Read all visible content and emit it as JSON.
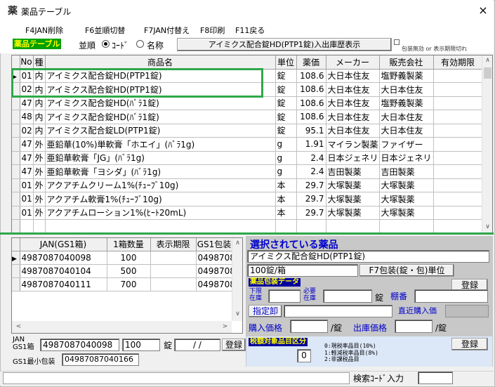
{
  "window": {
    "title": "薬品テーブル",
    "close_glyph": "×",
    "app_icon_glyph": "薬"
  },
  "menu": {
    "jan_delete": "F4JAN削除",
    "sort_toggle": "F6並順切替",
    "jan_toggle": "F7JAN付替え",
    "print": "F8印刷",
    "back": "F11戻る"
  },
  "toolbar": {
    "table_tag": "薬品テーブル",
    "sort_label": "並順",
    "sort_options": {
      "code": "ｺｰﾄﾞ",
      "name": "名称",
      "selected": "code"
    },
    "history_button": "アイミクス配合錠HD(PTP1錠)入出庫歴表示",
    "note": "包装無効 or 表示期限切れ"
  },
  "main_table": {
    "headers": [
      "No",
      "種",
      "商品名",
      "単位",
      "薬価",
      "メーカー",
      "販売会社",
      "有効期限"
    ],
    "rows": [
      {
        "no": "01",
        "type": "内",
        "name": "アイミクス配合錠HD(PTP1錠)",
        "unit": "錠",
        "price": "108.6",
        "maker": "大日本住友",
        "seller": "塩野義製薬",
        "expiry": "",
        "current": true
      },
      {
        "no": "02",
        "type": "内",
        "name": "アイミクス配合錠HD(PTP1錠)",
        "unit": "錠",
        "price": "108.6",
        "maker": "大日本住友",
        "seller": "大日本住友",
        "expiry": ""
      },
      {
        "no": "47",
        "type": "内",
        "name": "アイミクス配合錠HD(ﾊﾞﾗ1錠)",
        "unit": "錠",
        "price": "108.6",
        "maker": "大日本住友",
        "seller": "塩野義製薬",
        "expiry": ""
      },
      {
        "no": "48",
        "type": "内",
        "name": "アイミクス配合錠HD(ﾊﾞﾗ1錠)",
        "unit": "錠",
        "price": "108.6",
        "maker": "大日本住友",
        "seller": "大日本住友",
        "expiry": ""
      },
      {
        "no": "02",
        "type": "内",
        "name": "アイミクス配合錠LD(PTP1錠)",
        "unit": "錠",
        "price": "95.1",
        "maker": "大日本住友",
        "seller": "大日本住友",
        "expiry": ""
      },
      {
        "no": "47",
        "type": "外",
        "name": "亜鉛華(10%)単軟膏「ホエイ」(ﾊﾞﾗ1g)",
        "unit": "g",
        "price": "1.91",
        "maker": "マイラン製薬",
        "seller": "ファイザー",
        "expiry": ""
      },
      {
        "no": "47",
        "type": "外",
        "name": "亜鉛華軟膏「JG」(ﾊﾞﾗ1g)",
        "unit": "g",
        "price": "2.4",
        "maker": "日本ジェネリック",
        "seller": "日本ジェネリック",
        "expiry": ""
      },
      {
        "no": "47",
        "type": "外",
        "name": "亜鉛華軟膏「ヨシダ」(ﾊﾞﾗ1g)",
        "unit": "g",
        "price": "2.4",
        "maker": "吉田製薬",
        "seller": "吉田製薬",
        "expiry": ""
      },
      {
        "no": "01",
        "type": "外",
        "name": "アクアチムクリーム1%(ﾁｭｰﾌﾞ10g)",
        "unit": "本",
        "price": "29.7",
        "maker": "大塚製薬",
        "seller": "大塚製薬",
        "expiry": ""
      },
      {
        "no": "01",
        "type": "外",
        "name": "アクアチム軟膏1%(ﾁｭｰﾌﾞ10g)",
        "unit": "本",
        "price": "29.7",
        "maker": "大塚製薬",
        "seller": "大塚製薬",
        "expiry": ""
      },
      {
        "no": "01",
        "type": "外",
        "name": "アクアチムローション1%(ﾋｰﾄ20mL)",
        "unit": "本",
        "price": "29.7",
        "maker": "大塚製薬",
        "seller": "大塚製薬",
        "expiry": ""
      }
    ]
  },
  "jan_table": {
    "headers": [
      "JAN(GS1箱)",
      "1箱数量",
      "表示期限",
      "GS1包装"
    ],
    "rows": [
      {
        "jan": "4987087040098",
        "qty": "100",
        "expiry": "",
        "gs1": "0498708",
        "current": true
      },
      {
        "jan": "4987087040104",
        "qty": "500",
        "expiry": "",
        "gs1": "0498708"
      },
      {
        "jan": "4987087040111",
        "qty": "700",
        "expiry": "",
        "gs1": "0498708"
      }
    ]
  },
  "jan_entry": {
    "jan_label": "JAN",
    "gs1_box_label": "GS1箱",
    "jan_value": "4987087040098",
    "qty_value": "100",
    "unit": "錠",
    "date_value": "/ /",
    "register_button": "登録",
    "gs1_min_label": "GS1最小包装",
    "gs1_min_value": "04987087040166"
  },
  "selected": {
    "title": "選択されている薬品",
    "name": "アイミクス配合錠HD(PTP1錠)",
    "package": "100錠/箱",
    "f7_button": "F7包装(錠・包)単位",
    "package_data_tag": "薬品包装データ",
    "register_button": "登録",
    "lower_stock_label_1": "下限",
    "lower_stock_label_2": "在庫",
    "needed_stock_label_1": "必要",
    "needed_stock_label_2": "在庫",
    "unit": "錠",
    "shelf_label": "棚番",
    "designated_button": "指定卸",
    "recent_price_label": "直近購入価",
    "purchase_price_label": "購入価格",
    "purchase_unit": "/錠",
    "ship_price_label": "出庫価格",
    "ship_unit": "/錠"
  },
  "tax": {
    "tag": "税額対象品目区分",
    "value": "0",
    "register_button": "登録",
    "lines": [
      "0:現税率品目(10%)",
      "1:軽減税率品目(8%)",
      "2:非課税品目"
    ]
  },
  "status": {
    "search_label": "検索ｺｰﾄﾞ入力"
  },
  "colors": {
    "highlight": "#2ea84a",
    "title_blue": "#0000cc",
    "tag_green": "#00a000"
  }
}
